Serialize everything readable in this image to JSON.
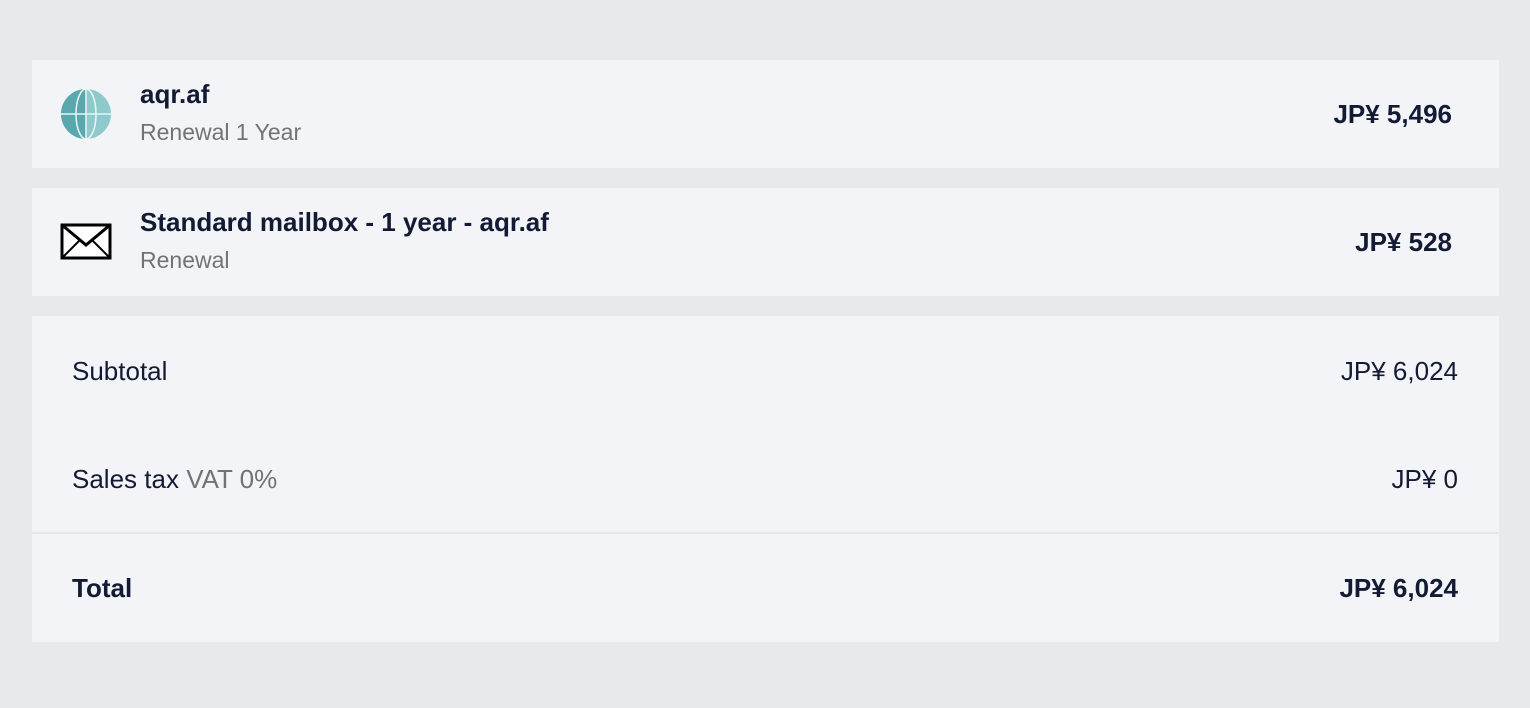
{
  "items": [
    {
      "name": "aqr.af",
      "subtitle": "Renewal 1 Year",
      "price": "JP¥ 5,496",
      "icon": "globe-icon"
    },
    {
      "name": "Standard mailbox - 1 year - aqr.af",
      "subtitle": "Renewal",
      "price": "JP¥ 528",
      "icon": "envelope-icon"
    }
  ],
  "summary": {
    "subtotal_label": "Subtotal",
    "subtotal_value": "JP¥ 6,024",
    "tax_label": "Sales tax",
    "tax_detail": "VAT 0%",
    "tax_value": "JP¥ 0",
    "total_label": "Total",
    "total_value": "JP¥ 6,024"
  },
  "colors": {
    "background": "#e7eaed",
    "card": "#f2f4f7",
    "text": "#131a33",
    "muted": "#707378",
    "globe": "#5aa7ad"
  }
}
